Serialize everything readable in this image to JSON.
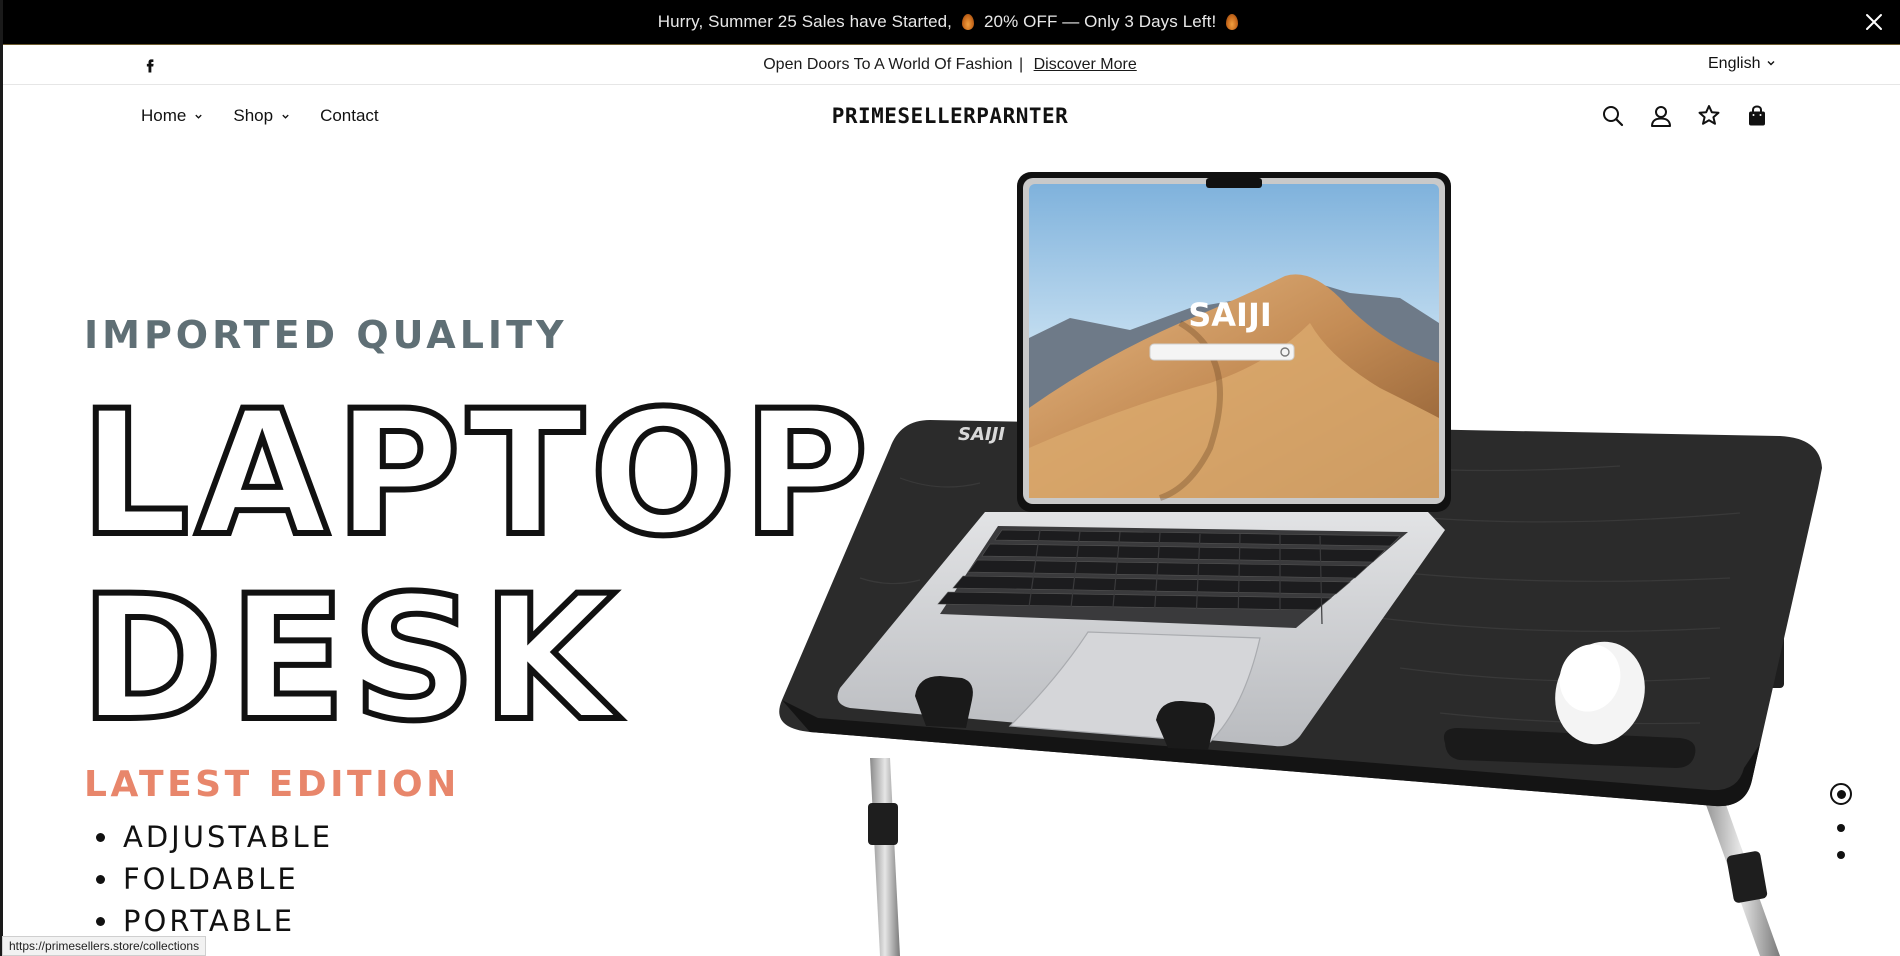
{
  "announcement": {
    "text_before": "Hurry, Summer 25 Sales have Started,",
    "text_middle": "20% OFF — Only 3 Days Left!",
    "close_icon": "close-icon"
  },
  "utility_bar": {
    "social_icon": "facebook-icon",
    "tagline": "Open Doors To A World Of Fashion",
    "separator": "|",
    "link_label": "Discover More",
    "language": "English"
  },
  "header": {
    "nav": [
      {
        "label": "Home",
        "has_dropdown": true
      },
      {
        "label": "Shop",
        "has_dropdown": true
      },
      {
        "label": "Contact",
        "has_dropdown": false
      }
    ],
    "logo": "PRIMESELLERPARNTER",
    "icons": [
      "search-icon",
      "account-icon",
      "wishlist-icon",
      "cart-icon"
    ]
  },
  "hero": {
    "kicker": "IMPORTED QUALITY",
    "title_line1": "LAPTOP",
    "title_line2": "DESK",
    "edition": "LATEST EDITION",
    "features": [
      "ADJUSTABLE",
      "FOLDABLE",
      "PORTABLE"
    ],
    "brand_on_product": "SAIJI",
    "slides_total": 3,
    "active_slide": 1
  },
  "colors": {
    "announcement_bg": "#000000",
    "kicker": "#5f6f75",
    "edition": "#e8866b",
    "desk": "#2c2c2c"
  },
  "status_bar": {
    "url": "https://primesellers.store/collections"
  }
}
